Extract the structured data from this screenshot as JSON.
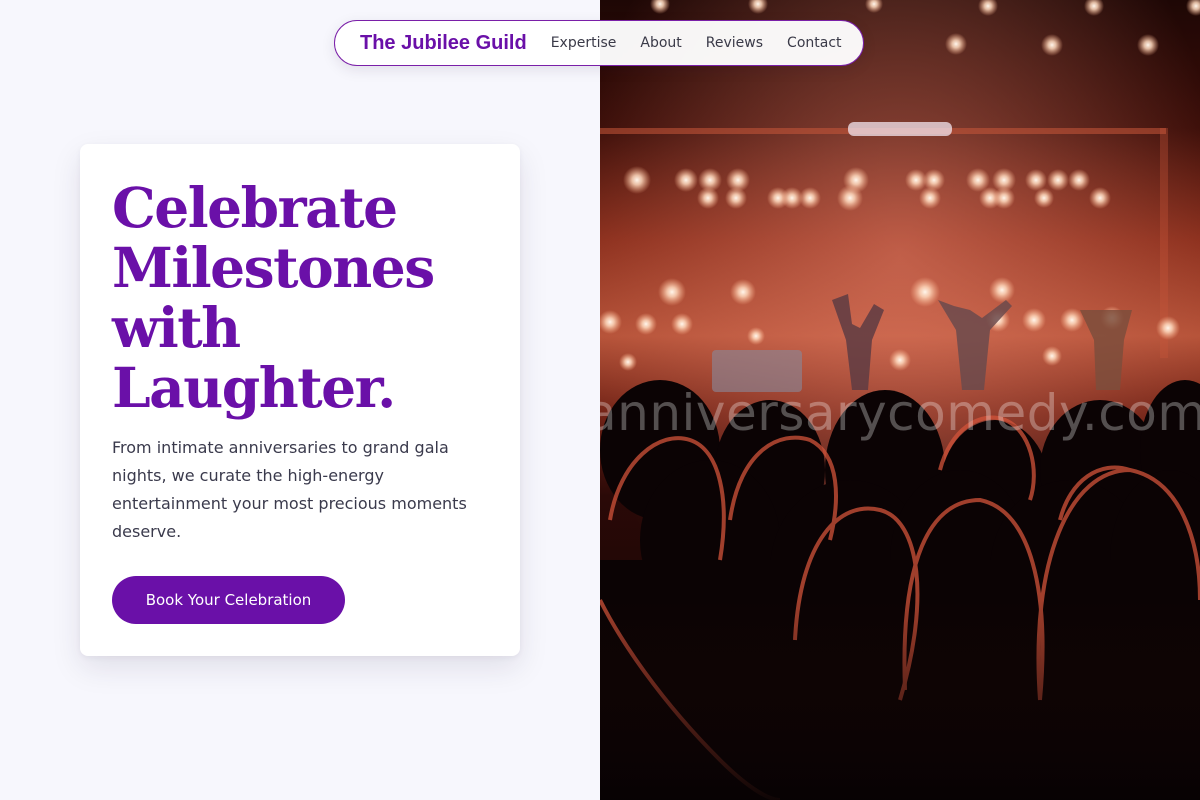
{
  "nav": {
    "brand": "The Jubilee Guild",
    "links": [
      "Expertise",
      "About",
      "Reviews",
      "Contact"
    ]
  },
  "hero": {
    "headline_lines": [
      "Celebrate",
      "Milestones",
      "with",
      "Laughter."
    ],
    "description": "From intimate anniversaries to grand gala nights, we curate the high-energy entertainment your most precious moments deserve.",
    "cta_label": "Book Your Celebration"
  },
  "photo": {
    "watermark": "anniversarycomedy.com"
  },
  "colors": {
    "accent": "#6a10a8",
    "page_background": "#f7f7fd",
    "body_text": "#3a3a4c"
  }
}
